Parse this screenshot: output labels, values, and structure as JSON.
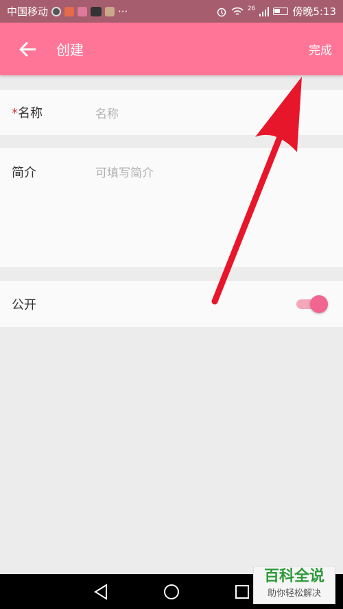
{
  "status_bar": {
    "carrier": "中国移动",
    "more": "···",
    "network": "26",
    "time": "傍晚5:13"
  },
  "app_bar": {
    "title": "创建",
    "done_label": "完成"
  },
  "form": {
    "name": {
      "required_mark": "*",
      "label": "名称",
      "placeholder": "名称"
    },
    "intro": {
      "label": "简介",
      "placeholder": "可填写简介"
    },
    "public": {
      "label": "公开",
      "value": true
    }
  },
  "watermark": {
    "title": "百科全说",
    "subtitle": "助你轻松解决"
  },
  "colors": {
    "app_bar": "#ff7597",
    "status_bar": "#a65e6e",
    "toggle_thumb": "#f06690",
    "arrow": "#e8162a"
  }
}
